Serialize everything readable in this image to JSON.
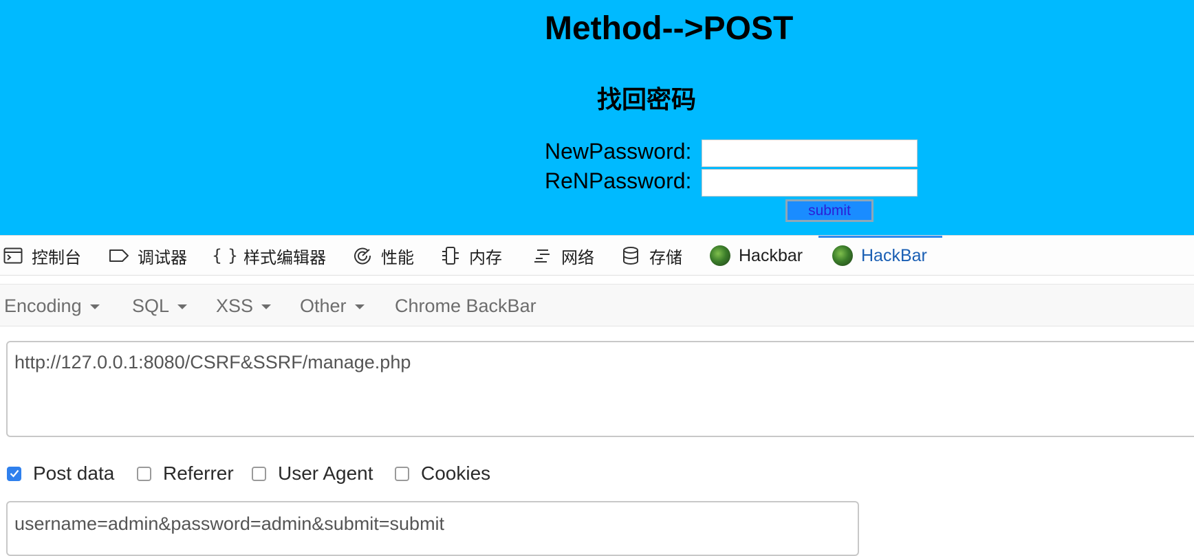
{
  "page": {
    "method_heading": "Method-->POST",
    "form_title": "找回密码",
    "new_password_label": "NewPassword:",
    "re_password_label": "ReNPassword:",
    "submit_label": "submit",
    "background_color": "#00baff"
  },
  "devtools": {
    "tabs": [
      {
        "label": "控制台",
        "icon": "console-icon"
      },
      {
        "label": "调试器",
        "icon": "debugger-icon"
      },
      {
        "label": "样式编辑器",
        "icon": "style-editor-icon"
      },
      {
        "label": "性能",
        "icon": "performance-icon"
      },
      {
        "label": "内存",
        "icon": "memory-icon"
      },
      {
        "label": "网络",
        "icon": "network-icon"
      },
      {
        "label": "存储",
        "icon": "storage-icon"
      },
      {
        "label": "Hackbar",
        "icon": "hackbar-icon"
      },
      {
        "label": "HackBar",
        "icon": "hackbar-icon",
        "active": true
      }
    ],
    "active_tab_color": "#1a5fb4"
  },
  "hackbar": {
    "menu": [
      {
        "label": "Encoding",
        "dropdown": true
      },
      {
        "label": "SQL",
        "dropdown": true
      },
      {
        "label": "XSS",
        "dropdown": true
      },
      {
        "label": "Other",
        "dropdown": true
      },
      {
        "label": "Chrome BackBar",
        "dropdown": false
      }
    ],
    "url": "http://127.0.0.1:8080/CSRF&SSRF/manage.php",
    "options": [
      {
        "label": "Post data",
        "checked": true
      },
      {
        "label": "Referrer",
        "checked": false
      },
      {
        "label": "User Agent",
        "checked": false
      },
      {
        "label": "Cookies",
        "checked": false
      }
    ],
    "post_data": "username=admin&password=admin&submit=submit"
  }
}
